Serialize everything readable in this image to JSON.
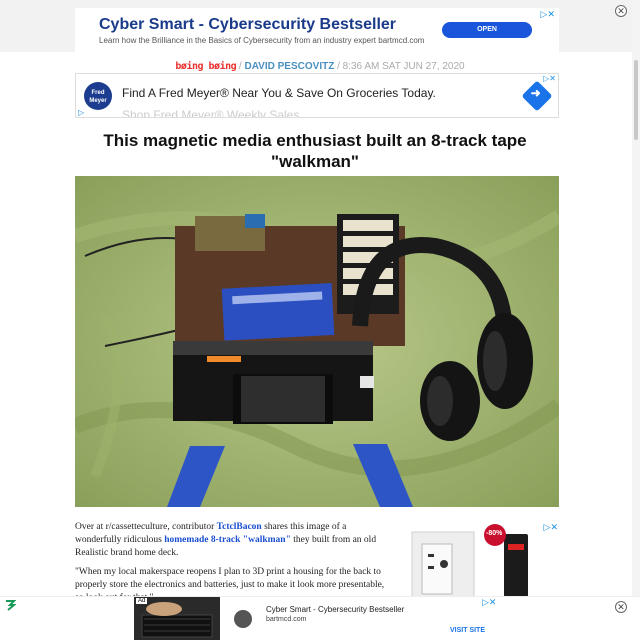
{
  "top_ad": {
    "headline": "Cyber Smart - Cybersecurity Bestseller",
    "subline": "Learn how the Brilliance in the Basics of Cybersecurity from an industry expert bartmcd.com",
    "cta": "OPEN",
    "adchoices": "▷✕",
    "close": "✕"
  },
  "byline": {
    "site_logo": "bøing bøing",
    "sep1": " / ",
    "author": "DAVID PESCOVITZ",
    "sep2": " / ",
    "timestamp": "8:36 AM SAT JUN 27, 2020"
  },
  "mid_ad": {
    "logo": "Fred Meyer",
    "headline": "Find A Fred Meyer® Near You & Save On Groceries Today.",
    "subline": "Shop Fred Meyer® Weekly Sales",
    "adchoices": "▷✕",
    "adchoices_left": "▷"
  },
  "article": {
    "title": "This magnetic media enthusiast built an 8-track tape \"walkman\"",
    "p1_a": "Over at r/cassetteculture, contributor ",
    "p1_link1": "TctclBacon",
    "p1_b": " shares this image of a wonderfully ridiculous ",
    "p1_link2": "homemade 8-track \"walkman\"",
    "p1_c": " they built from an old Realistic brand home deck.",
    "p2": "\"When my local makerspace reopens I plan to 3D print a housing for the back to properly store the electronics and batteries, just to make it look more presentable, so look out for that.\""
  },
  "side_ad": {
    "badge": "-80%",
    "adchoices": "▷✕"
  },
  "bottom_ad": {
    "ad_tag": "Ad",
    "headline": "Cyber Smart - Cybersecurity Bestseller",
    "domain": "bartmcd.com",
    "cta": "VISIT SITE",
    "adchoices": "▷✕",
    "close": "✕"
  },
  "colors": {
    "brand_red": "#e8322f",
    "link_blue": "#1a4fd0",
    "author_blue": "#4a90c0",
    "cta_blue": "#1a56db"
  }
}
